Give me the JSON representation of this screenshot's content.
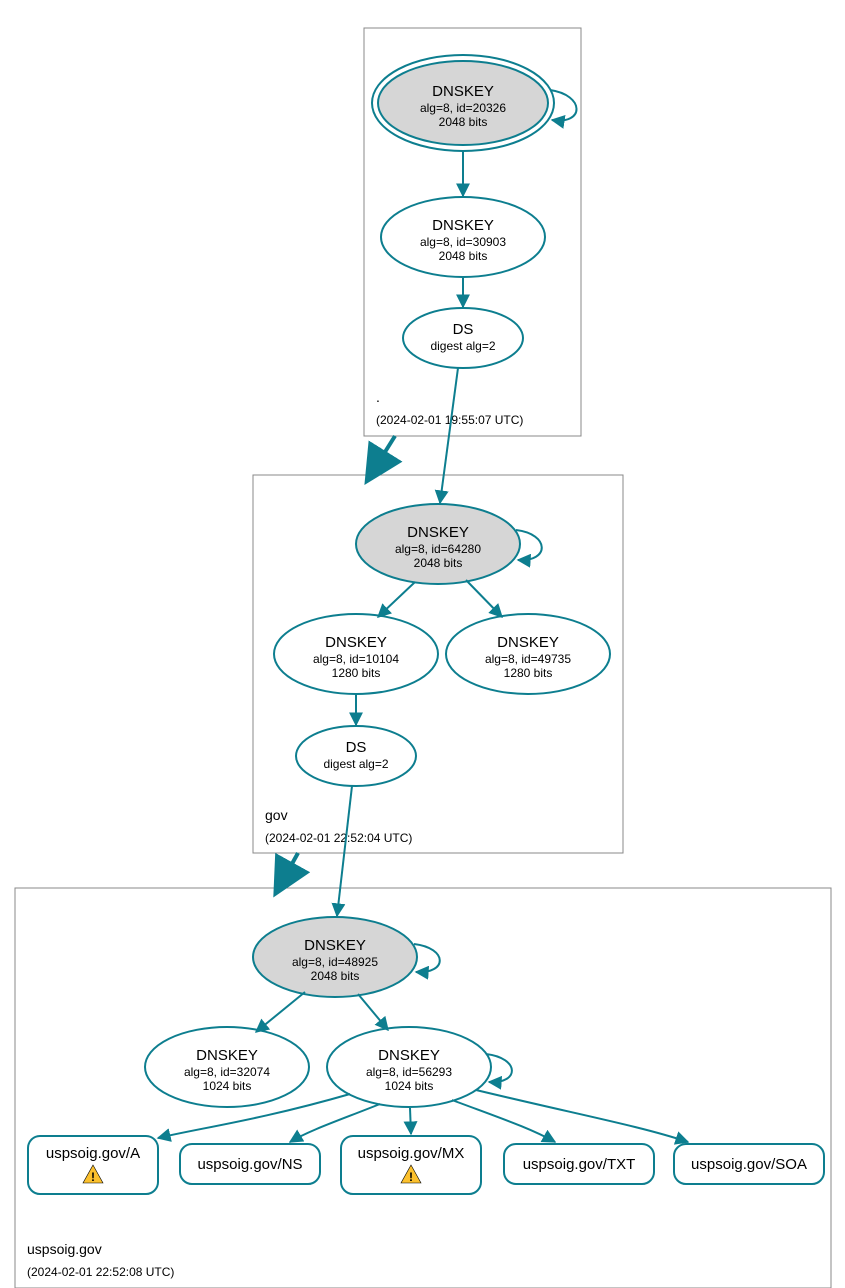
{
  "colors": {
    "stroke": "#0d7e8f",
    "fill_key": "#d6d6d6"
  },
  "zones": {
    "root": {
      "label": ".",
      "time": "(2024-02-01 19:55:07 UTC)"
    },
    "gov": {
      "label": "gov",
      "time": "(2024-02-01 22:52:04 UTC)"
    },
    "domain": {
      "label": "uspsoig.gov",
      "time": "(2024-02-01 22:52:08 UTC)"
    }
  },
  "nodes": {
    "root_ksk": {
      "title": "DNSKEY",
      "line1": "alg=8, id=20326",
      "line2": "2048 bits"
    },
    "root_zsk": {
      "title": "DNSKEY",
      "line1": "alg=8, id=30903",
      "line2": "2048 bits"
    },
    "root_ds": {
      "title": "DS",
      "line1": "digest alg=2"
    },
    "gov_ksk": {
      "title": "DNSKEY",
      "line1": "alg=8, id=64280",
      "line2": "2048 bits"
    },
    "gov_zsk1": {
      "title": "DNSKEY",
      "line1": "alg=8, id=10104",
      "line2": "1280 bits"
    },
    "gov_zsk2": {
      "title": "DNSKEY",
      "line1": "alg=8, id=49735",
      "line2": "1280 bits"
    },
    "gov_ds": {
      "title": "DS",
      "line1": "digest alg=2"
    },
    "dom_ksk": {
      "title": "DNSKEY",
      "line1": "alg=8, id=48925",
      "line2": "2048 bits"
    },
    "dom_zsk1": {
      "title": "DNSKEY",
      "line1": "alg=8, id=32074",
      "line2": "1024 bits"
    },
    "dom_zsk2": {
      "title": "DNSKEY",
      "line1": "alg=8, id=56293",
      "line2": "1024 bits"
    },
    "rr_a": {
      "label": "uspsoig.gov/A",
      "warn": true
    },
    "rr_ns": {
      "label": "uspsoig.gov/NS"
    },
    "rr_mx": {
      "label": "uspsoig.gov/MX",
      "warn": true
    },
    "rr_txt": {
      "label": "uspsoig.gov/TXT"
    },
    "rr_soa": {
      "label": "uspsoig.gov/SOA"
    }
  }
}
